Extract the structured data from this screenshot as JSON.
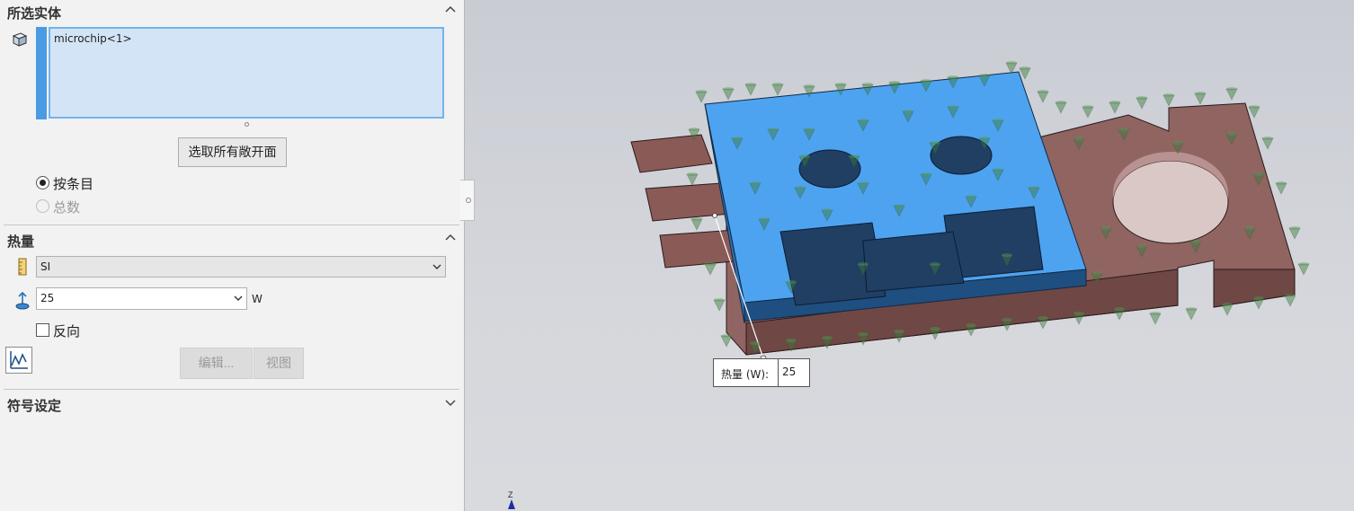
{
  "selected_entities": {
    "title": "所选实体",
    "items": [
      "microchip<1>"
    ],
    "select_all_button": "选取所有敞开面",
    "radio_by_entry": "按条目",
    "radio_total": "总数"
  },
  "heat": {
    "title": "热量",
    "unit_system": "SI",
    "value": "25",
    "unit": "W",
    "reverse_label": "反向",
    "edit_button": "编辑...",
    "view_button": "视图"
  },
  "symbol_settings": {
    "title": "符号设定"
  },
  "callout": {
    "label": "热量 (W):",
    "value": "25"
  },
  "axis": {
    "z_label": "Z"
  },
  "colors": {
    "selection_blue": "#4b9be4",
    "chip_blue": "#4da3f0",
    "board_red": "#8a5a57",
    "arrow_green": "#3c7a3c"
  }
}
